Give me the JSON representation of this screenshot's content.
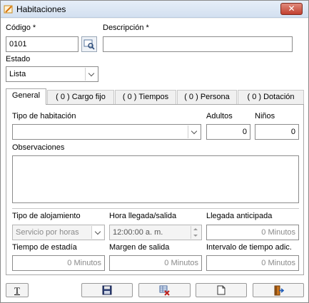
{
  "window": {
    "title": "Habitaciones",
    "close_label": "✕"
  },
  "form": {
    "codigo_label": "Código *",
    "codigo_value": "0101",
    "descripcion_label": "Descripción *",
    "descripcion_value": "",
    "estado_label": "Estado",
    "estado_value": "Lista"
  },
  "tabs": [
    {
      "label": "General"
    },
    {
      "label": "( 0 ) Cargo fijo"
    },
    {
      "label": "( 0 ) Tiempos"
    },
    {
      "label": "( 0 ) Persona"
    },
    {
      "label": "( 0 ) Dotación"
    }
  ],
  "general": {
    "tipo_habitacion_label": "Tipo de habitación",
    "tipo_habitacion_value": "",
    "adultos_label": "Adultos",
    "adultos_value": "0",
    "ninos_label": "Niños",
    "ninos_value": "0",
    "observaciones_label": "Observaciones",
    "tipo_alojamiento_label": "Tipo de alojamiento",
    "tipo_alojamiento_value": "Servicio por horas",
    "hora_label": "Hora llegada/salida",
    "hora_value": "12:00:00 a. m.",
    "llegada_anticipada_label": "Llegada anticipada",
    "llegada_anticipada_value": "0 Minutos",
    "tiempo_estadia_label": "Tiempo de estadía",
    "tiempo_estadia_value": "0 Minutos",
    "margen_salida_label": "Margen de salida",
    "margen_salida_value": "0 Minutos",
    "intervalo_label": "Intervalo de tiempo adic.",
    "intervalo_value": "0 Minutos"
  },
  "toolbar": {
    "text_button_glyph": "T",
    "icons": [
      "text-format-icon",
      "save-icon",
      "delete-icon",
      "new-document-icon",
      "exit-icon"
    ]
  }
}
